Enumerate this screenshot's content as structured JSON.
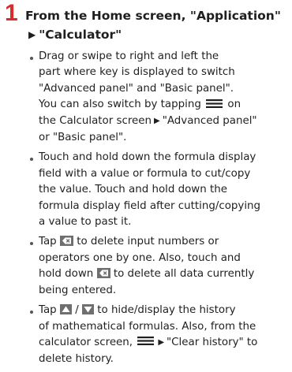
{
  "step": {
    "number": "1",
    "line1": "From the Home screen, \"Application\"",
    "arrow": "▶",
    "line2": "\"Calculator\""
  },
  "arrow": "▶",
  "bullets": [
    {
      "lines": [
        "Drag or swipe to right and left the",
        "part where key is displayed to switch",
        "\"Advanced panel\" and \"Basic panel\".",
        "You can also switch by tapping",
        "on",
        "the Calculator screen",
        "\"Advanced panel\"",
        "or \"Basic panel\"."
      ]
    },
    {
      "lines": [
        "Touch and hold down the formula display",
        "field with a value or formula to cut/copy",
        "the value. Touch and hold down the",
        "formula display field after cutting/copying",
        "a value to past it."
      ]
    },
    {
      "lines": [
        "Tap",
        "to delete input numbers or",
        "operators one by one. Also, touch and",
        "hold down",
        "to delete all data currently",
        "being entered."
      ]
    },
    {
      "lines": [
        "Tap",
        "/",
        "to hide/display the history",
        "of mathematical formulas. Also, from the",
        "calculator screen,",
        "\"Clear history\" to",
        "delete history."
      ]
    }
  ],
  "colors": {
    "step_number": "#d92b2b",
    "text": "#1f1f1f",
    "icon_bg": "#6f6f6f"
  },
  "icons": [
    "menu-icon",
    "delete-key-icon",
    "history-up-icon",
    "history-down-icon"
  ]
}
